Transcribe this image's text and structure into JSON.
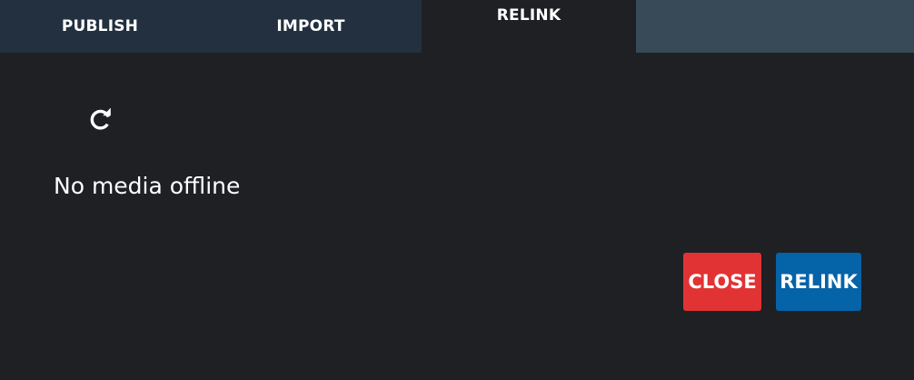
{
  "tabs": {
    "publish": "PUBLISH",
    "import": "IMPORT",
    "relink": "RELINK"
  },
  "active_tab": "relink",
  "refresh_icon": "refresh-icon",
  "status": {
    "message": "No media offline"
  },
  "buttons": {
    "close": "CLOSE",
    "relink": "RELINK"
  },
  "colors": {
    "background": "#1e2024",
    "tab_inactive": "#22303f",
    "tab_bar_empty": "#384a58",
    "close_button": "#e13334",
    "relink_button": "#0563a8",
    "text": "#ffffff"
  }
}
